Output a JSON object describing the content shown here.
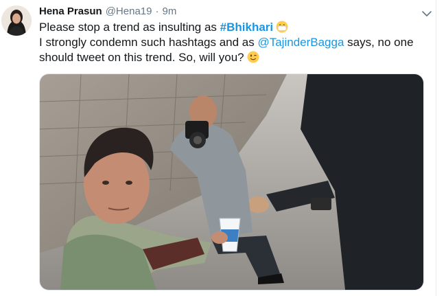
{
  "tweet": {
    "name": "Hena Prasun",
    "handle": "@Hena19",
    "separator": "·",
    "time": "9m",
    "line1_prefix": "Please stop a trend as insulting as ",
    "hashtag": "#Bhikhari",
    "line2_prefix": "I strongly condemn such hashtags and as ",
    "mention": "@TajinderBagga",
    "line2_suffix": " says, no one",
    "line3": "should tweet on this trend. So, will you?",
    "emoji_1": "grimacing-mask-face-emoji",
    "emoji_2": "winking-face-emoji"
  },
  "colors": {
    "link": "#1b95e0",
    "text": "#14171a",
    "secondary": "#657786"
  },
  "icons": {
    "menu": "chevron-down-icon"
  }
}
